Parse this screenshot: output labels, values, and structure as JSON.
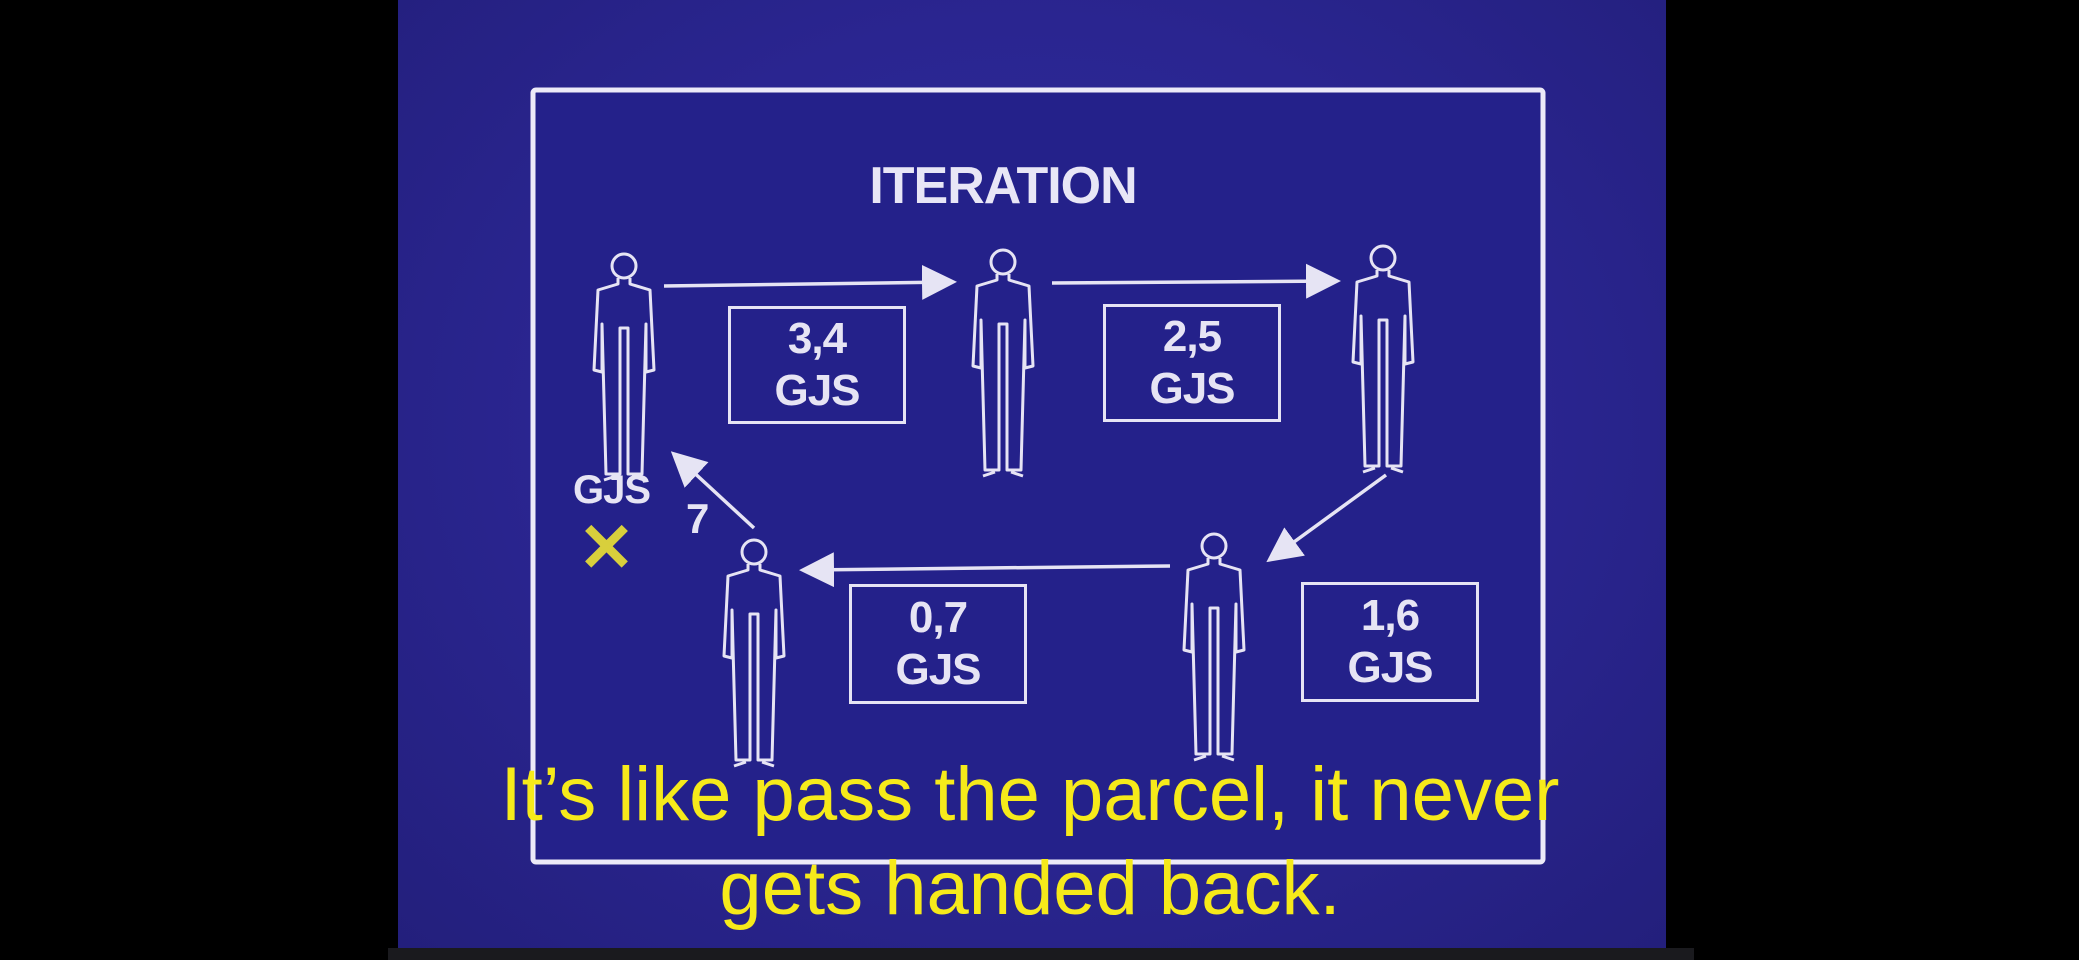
{
  "slide": {
    "title": "ITERATION",
    "boxes": [
      {
        "amount": "3,4",
        "unit": "GJS"
      },
      {
        "amount": "2,5",
        "unit": "GJS"
      },
      {
        "amount": "0,7",
        "unit": "GJS"
      },
      {
        "amount": "1,6",
        "unit": "GJS"
      }
    ],
    "start_label": "GJS",
    "step_label": "7"
  },
  "caption": {
    "line1": "It’s like pass the parcel, it never",
    "line2": "gets handed back."
  },
  "colors": {
    "background": "#2a2590",
    "line": "#e6e4f4",
    "subtitle": "#f6ea1a",
    "cross": "#d8cf3c"
  },
  "icons": [
    "person-icon",
    "arrow-icon",
    "cross-icon"
  ]
}
